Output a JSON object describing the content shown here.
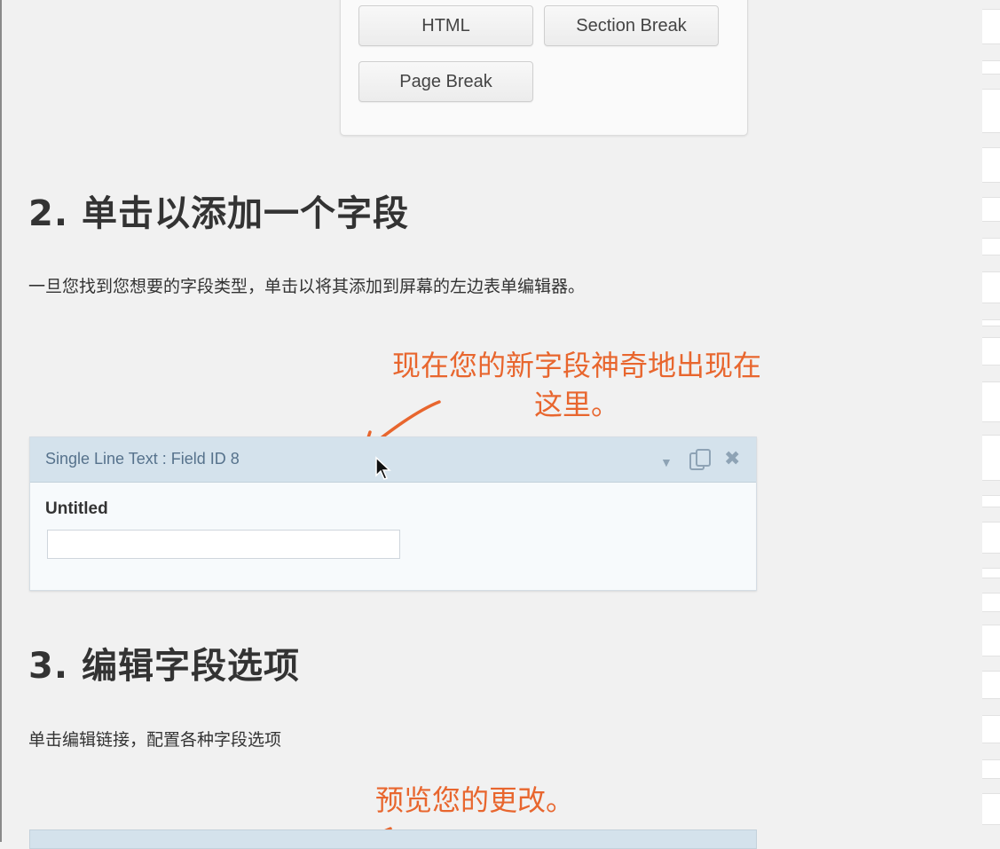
{
  "field_types": {
    "html_label": "HTML",
    "section_break_label": "Section Break",
    "page_break_label": "Page Break"
  },
  "steps": [
    {
      "heading": "2. 单击以添加一个字段",
      "description": "一旦您找到您想要的字段类型，单击以将其添加到屏幕的左边表单编辑器。"
    },
    {
      "heading": "3. 编辑字段选项",
      "description": "单击编辑链接，配置各种字段选项"
    }
  ],
  "annotations": {
    "new_field_line1": "现在您的新字段神奇地出现在",
    "new_field_line2": "这里。",
    "preview_changes": "预览您的更改。"
  },
  "field_card": {
    "title": "Single Line Text : Field ID 8",
    "label": "Untitled",
    "input_value": ""
  },
  "icons": {
    "dropdown": "chevron-down-icon",
    "duplicate": "duplicate-icon",
    "delete": "close-icon"
  },
  "colors": {
    "annotation": "#e8662e",
    "card_header": "#d4e2ec",
    "card_title": "#56728c"
  }
}
